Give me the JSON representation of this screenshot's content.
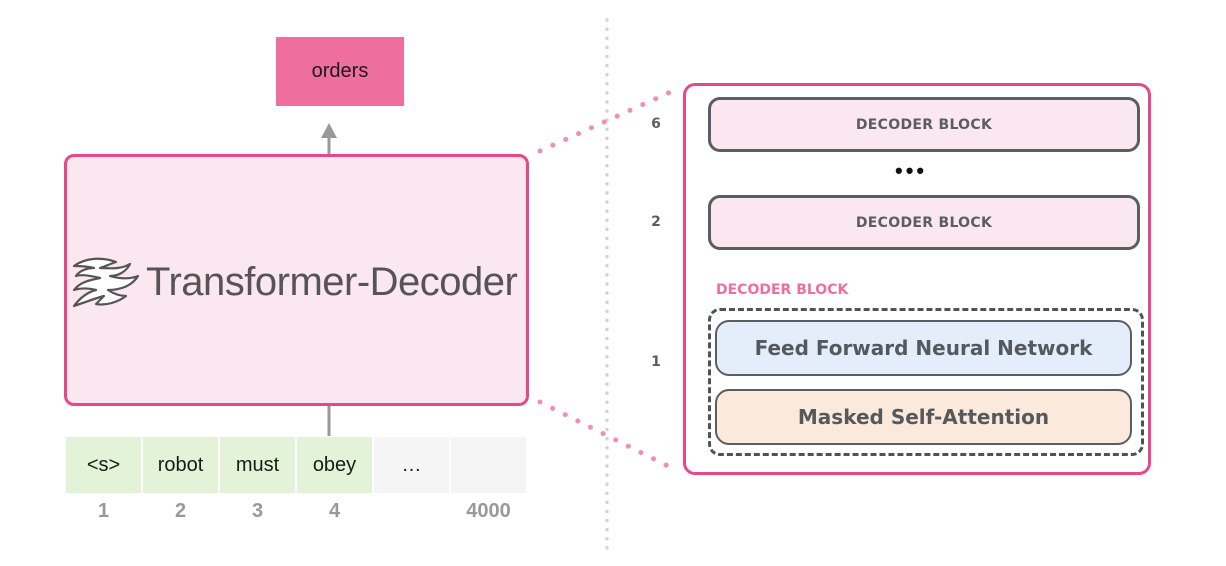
{
  "output_token": "orders",
  "decoder": {
    "title": "Transformer-Decoder",
    "logo_icon": "transformer-logo-icon"
  },
  "input_tokens": [
    {
      "text": "<s>",
      "position": "1",
      "filled": true
    },
    {
      "text": "robot",
      "position": "2",
      "filled": true
    },
    {
      "text": "must",
      "position": "3",
      "filled": true
    },
    {
      "text": "obey",
      "position": "4",
      "filled": true
    },
    {
      "text": "…",
      "position": "",
      "filled": false
    },
    {
      "text": "",
      "position": "4000",
      "filled": false
    }
  ],
  "stack": {
    "blocks": [
      {
        "layer": "6",
        "label": "DECODER BLOCK"
      },
      {
        "layer": "2",
        "label": "DECODER BLOCK"
      }
    ],
    "ellipsis": "•••",
    "expanded_block": {
      "layer": "1",
      "label": "DECODER BLOCK",
      "sublayers": [
        "Feed Forward Neural Network",
        "Masked Self-Attention"
      ]
    }
  },
  "colors": {
    "accent_pink": "#e8488a",
    "output_fill": "#ee6f9b",
    "decoder_fill": "#fbe7ef",
    "token_fill": "#e2f3d8",
    "empty_token_fill": "#f5f5f5",
    "ffnn_fill": "#e4eefb",
    "attention_fill": "#fbeadb",
    "block_stroke": "#5a5e63"
  }
}
